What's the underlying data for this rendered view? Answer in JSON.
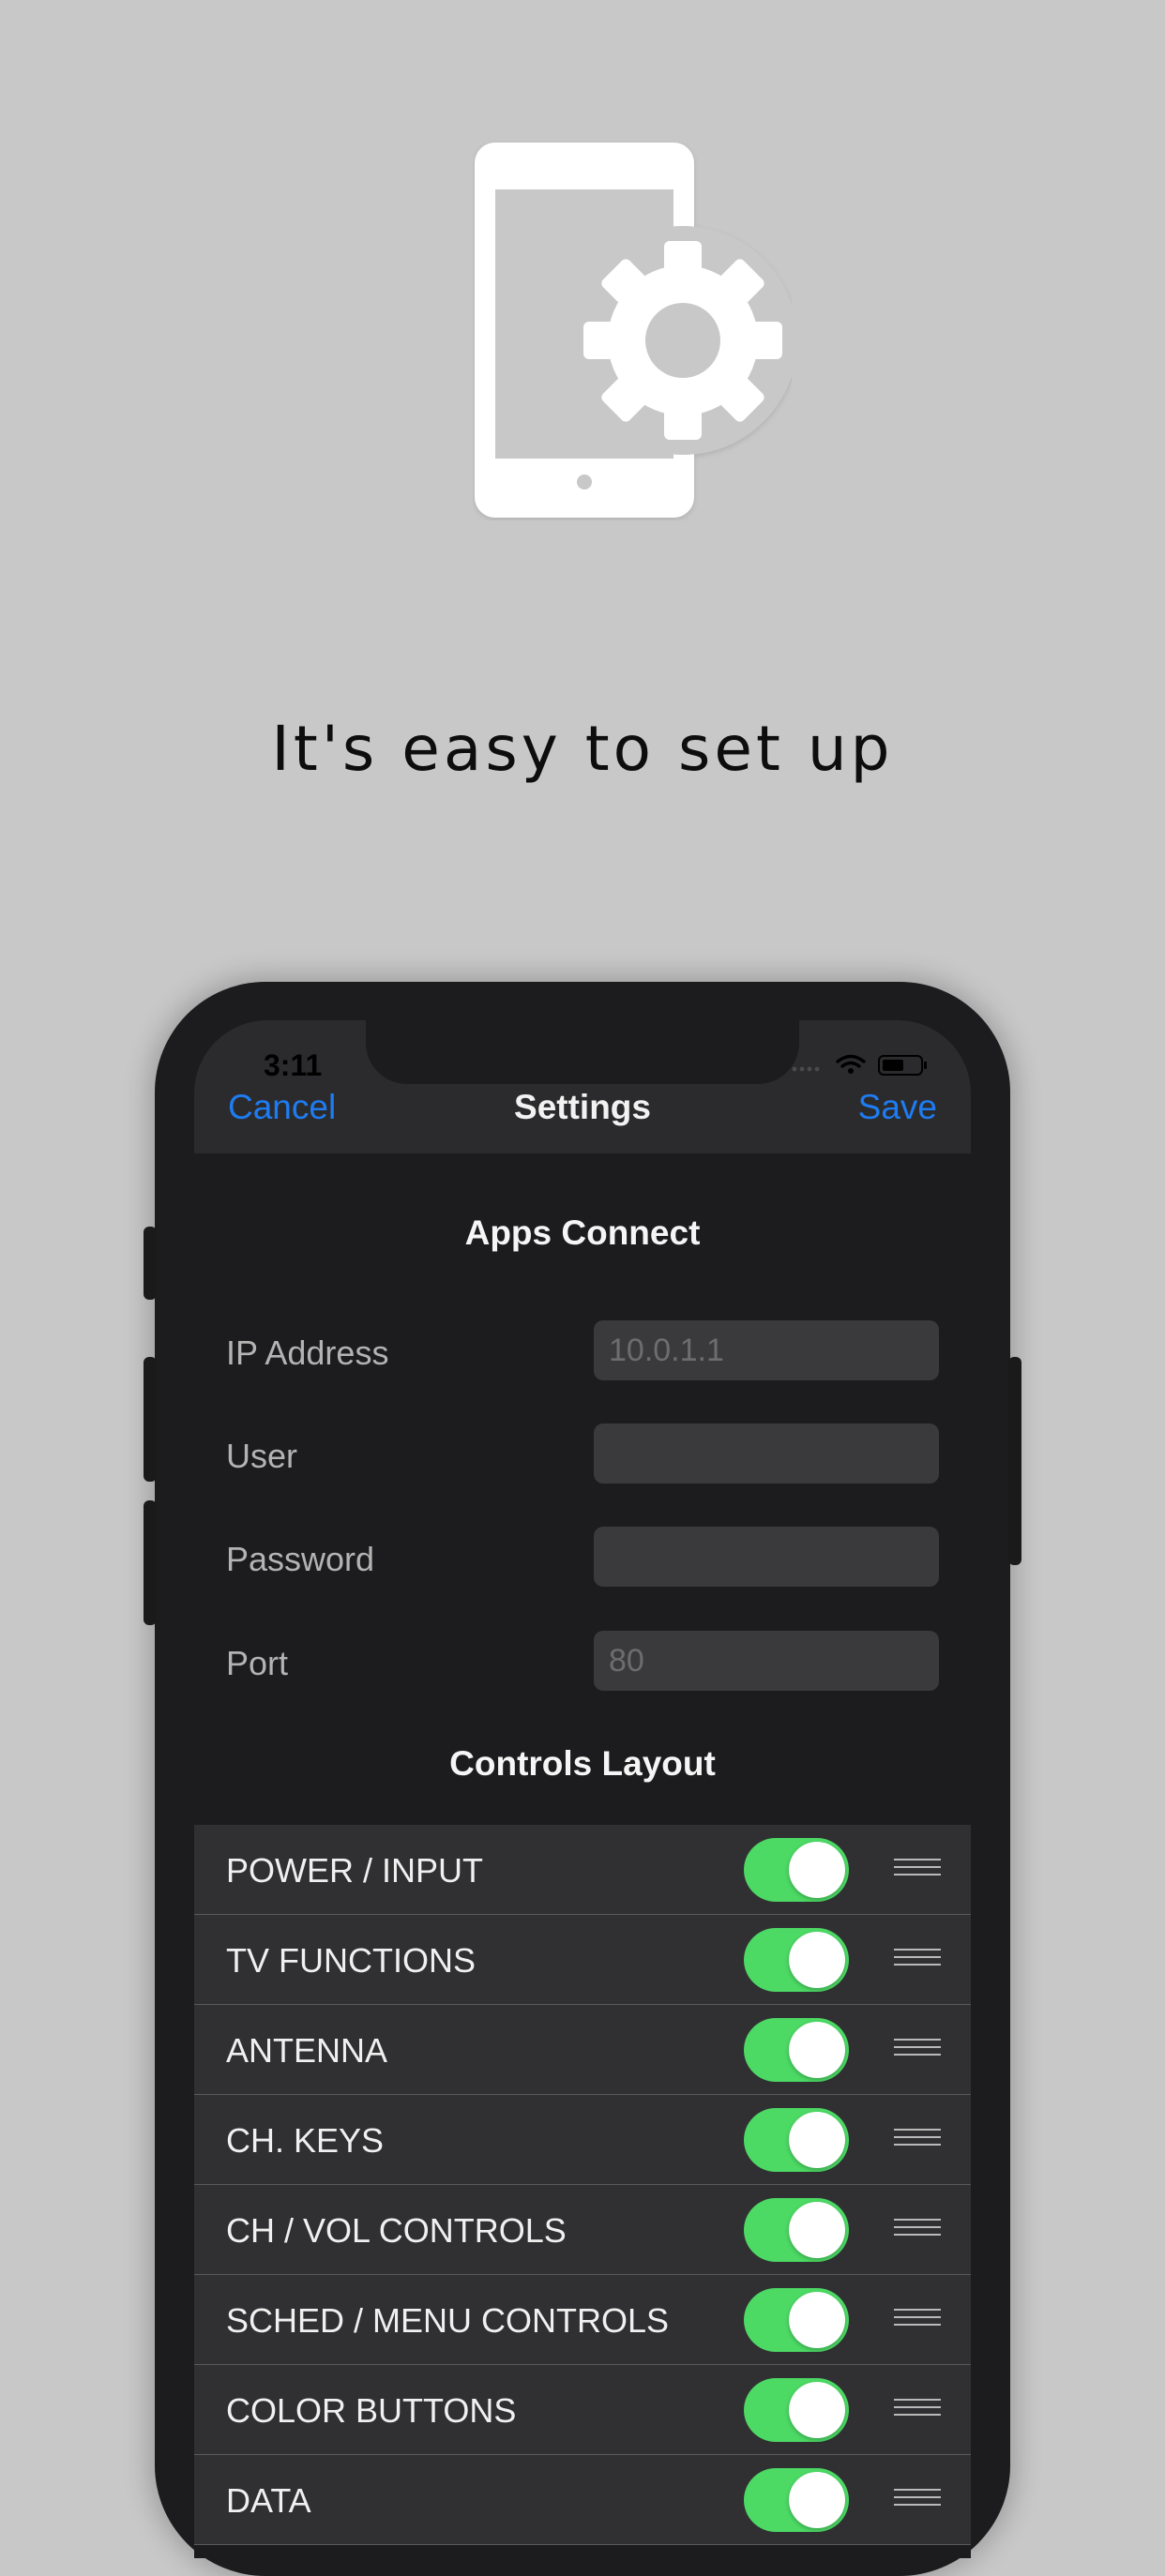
{
  "tagline": "It's easy to set up",
  "status": {
    "time": "3:11"
  },
  "navbar": {
    "cancel": "Cancel",
    "title": "Settings",
    "save": "Save"
  },
  "apps_connect": {
    "title": "Apps Connect",
    "fields": [
      {
        "label": "IP Address",
        "placeholder": "10.0.1.1",
        "value": ""
      },
      {
        "label": "User",
        "placeholder": "",
        "value": ""
      },
      {
        "label": "Password",
        "placeholder": "",
        "value": ""
      },
      {
        "label": "Port",
        "placeholder": "80",
        "value": ""
      }
    ]
  },
  "controls_layout": {
    "title": "Controls Layout",
    "items": [
      {
        "label": "POWER / INPUT",
        "enabled": true
      },
      {
        "label": "TV FUNCTIONS",
        "enabled": true
      },
      {
        "label": "ANTENNA",
        "enabled": true
      },
      {
        "label": "CH. KEYS",
        "enabled": true
      },
      {
        "label": "CH / VOL CONTROLS",
        "enabled": true
      },
      {
        "label": "SCHED / MENU CONTROLS",
        "enabled": true
      },
      {
        "label": "COLOR BUTTONS",
        "enabled": true
      },
      {
        "label": "DATA",
        "enabled": true
      }
    ]
  },
  "icons": {
    "hero": "phone-settings-icon",
    "wifi": "wifi-icon",
    "battery": "battery-icon",
    "reorder": "reorder-handle-icon"
  },
  "colors": {
    "accent": "#1e7cf2",
    "toggle_on": "#4cd964",
    "background": "#c8c8c8"
  }
}
